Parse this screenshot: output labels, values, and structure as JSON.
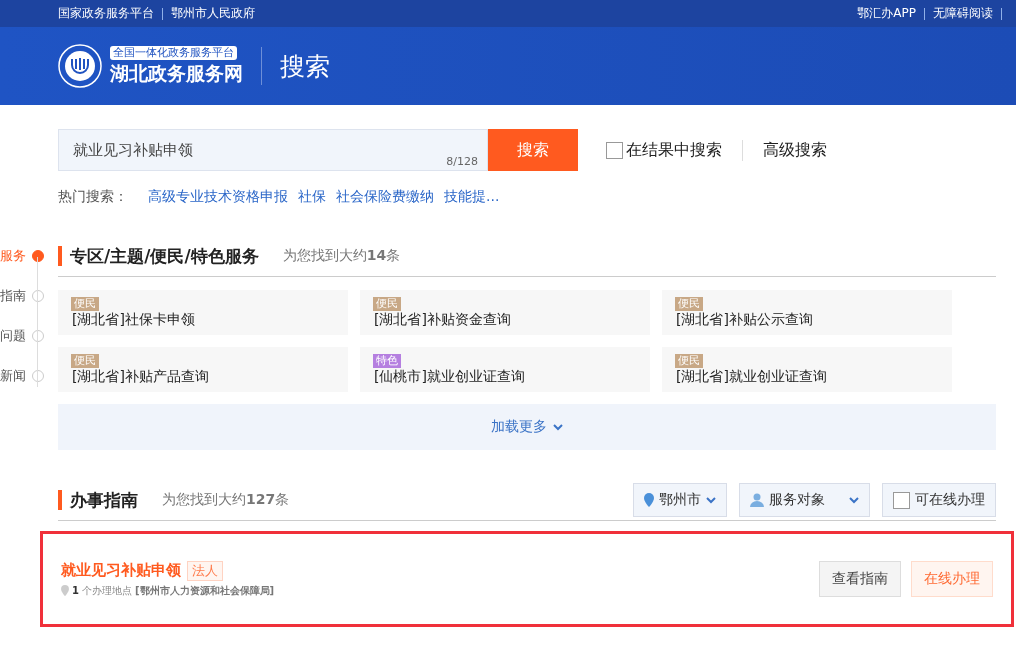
{
  "top_bar": {
    "left_links": [
      "国家政务服务平台",
      "鄂州市人民政府"
    ],
    "right_links": [
      "鄂汇办APP",
      "无障碍阅读"
    ]
  },
  "header": {
    "logo_badge": "全国一体化政务服务平台",
    "logo_title": "湖北政务服务网",
    "page_title": "搜索"
  },
  "search": {
    "value": "就业见习补贴申领",
    "counter": "8/128",
    "button": "搜索",
    "in_results": {
      "label": "在结果中搜索",
      "checked": false
    },
    "advanced": "高级搜索"
  },
  "hot_search": {
    "label": "热门搜索：",
    "items": [
      "高级专业技术资格申报",
      "社保",
      "社会保险费缴纳",
      "技能提..."
    ]
  },
  "side_nav": [
    {
      "label": "服务",
      "selected": true
    },
    {
      "label": "指南",
      "selected": false
    },
    {
      "label": "问题",
      "selected": false
    },
    {
      "label": "新闻",
      "selected": false
    }
  ],
  "special_section": {
    "title": "专区/主题/便民/特色服务",
    "count_text": "为您找到大约**14**条",
    "cards": [
      {
        "tag": "便民",
        "color": "#c8a886",
        "title": "[湖北省]社保卡申领"
      },
      {
        "tag": "便民",
        "color": "#c8a886",
        "title": "[湖北省]补贴资金查询"
      },
      {
        "tag": "便民",
        "color": "#c8a886",
        "title": "[湖北省]补贴公示查询"
      },
      {
        "tag": "便民",
        "color": "#c8a886",
        "title": "[湖北省]补贴产品查询"
      },
      {
        "tag": "特色",
        "color": "#b57fe0",
        "title": "[仙桃市]就业创业证查询"
      },
      {
        "tag": "便民",
        "color": "#c8a886",
        "title": "[湖北省]就业创业证查询"
      }
    ],
    "load_more": "加载更多"
  },
  "guide_section": {
    "title": "办事指南",
    "count_text": "为您找到大约**127**条",
    "filters": {
      "region": "鄂州市",
      "audience": "服务对象",
      "online_only": {
        "label": "可在线办理",
        "checked": false
      }
    },
    "results": [
      {
        "title": "就业见习补贴申领",
        "tag": "法人",
        "location_count": "1",
        "location_text": "个办理地点",
        "department": "[鄂州市人力资源和社会保障局]",
        "highlighted": true,
        "buttons": [
          "查看指南",
          "在线办理"
        ]
      }
    ]
  }
}
